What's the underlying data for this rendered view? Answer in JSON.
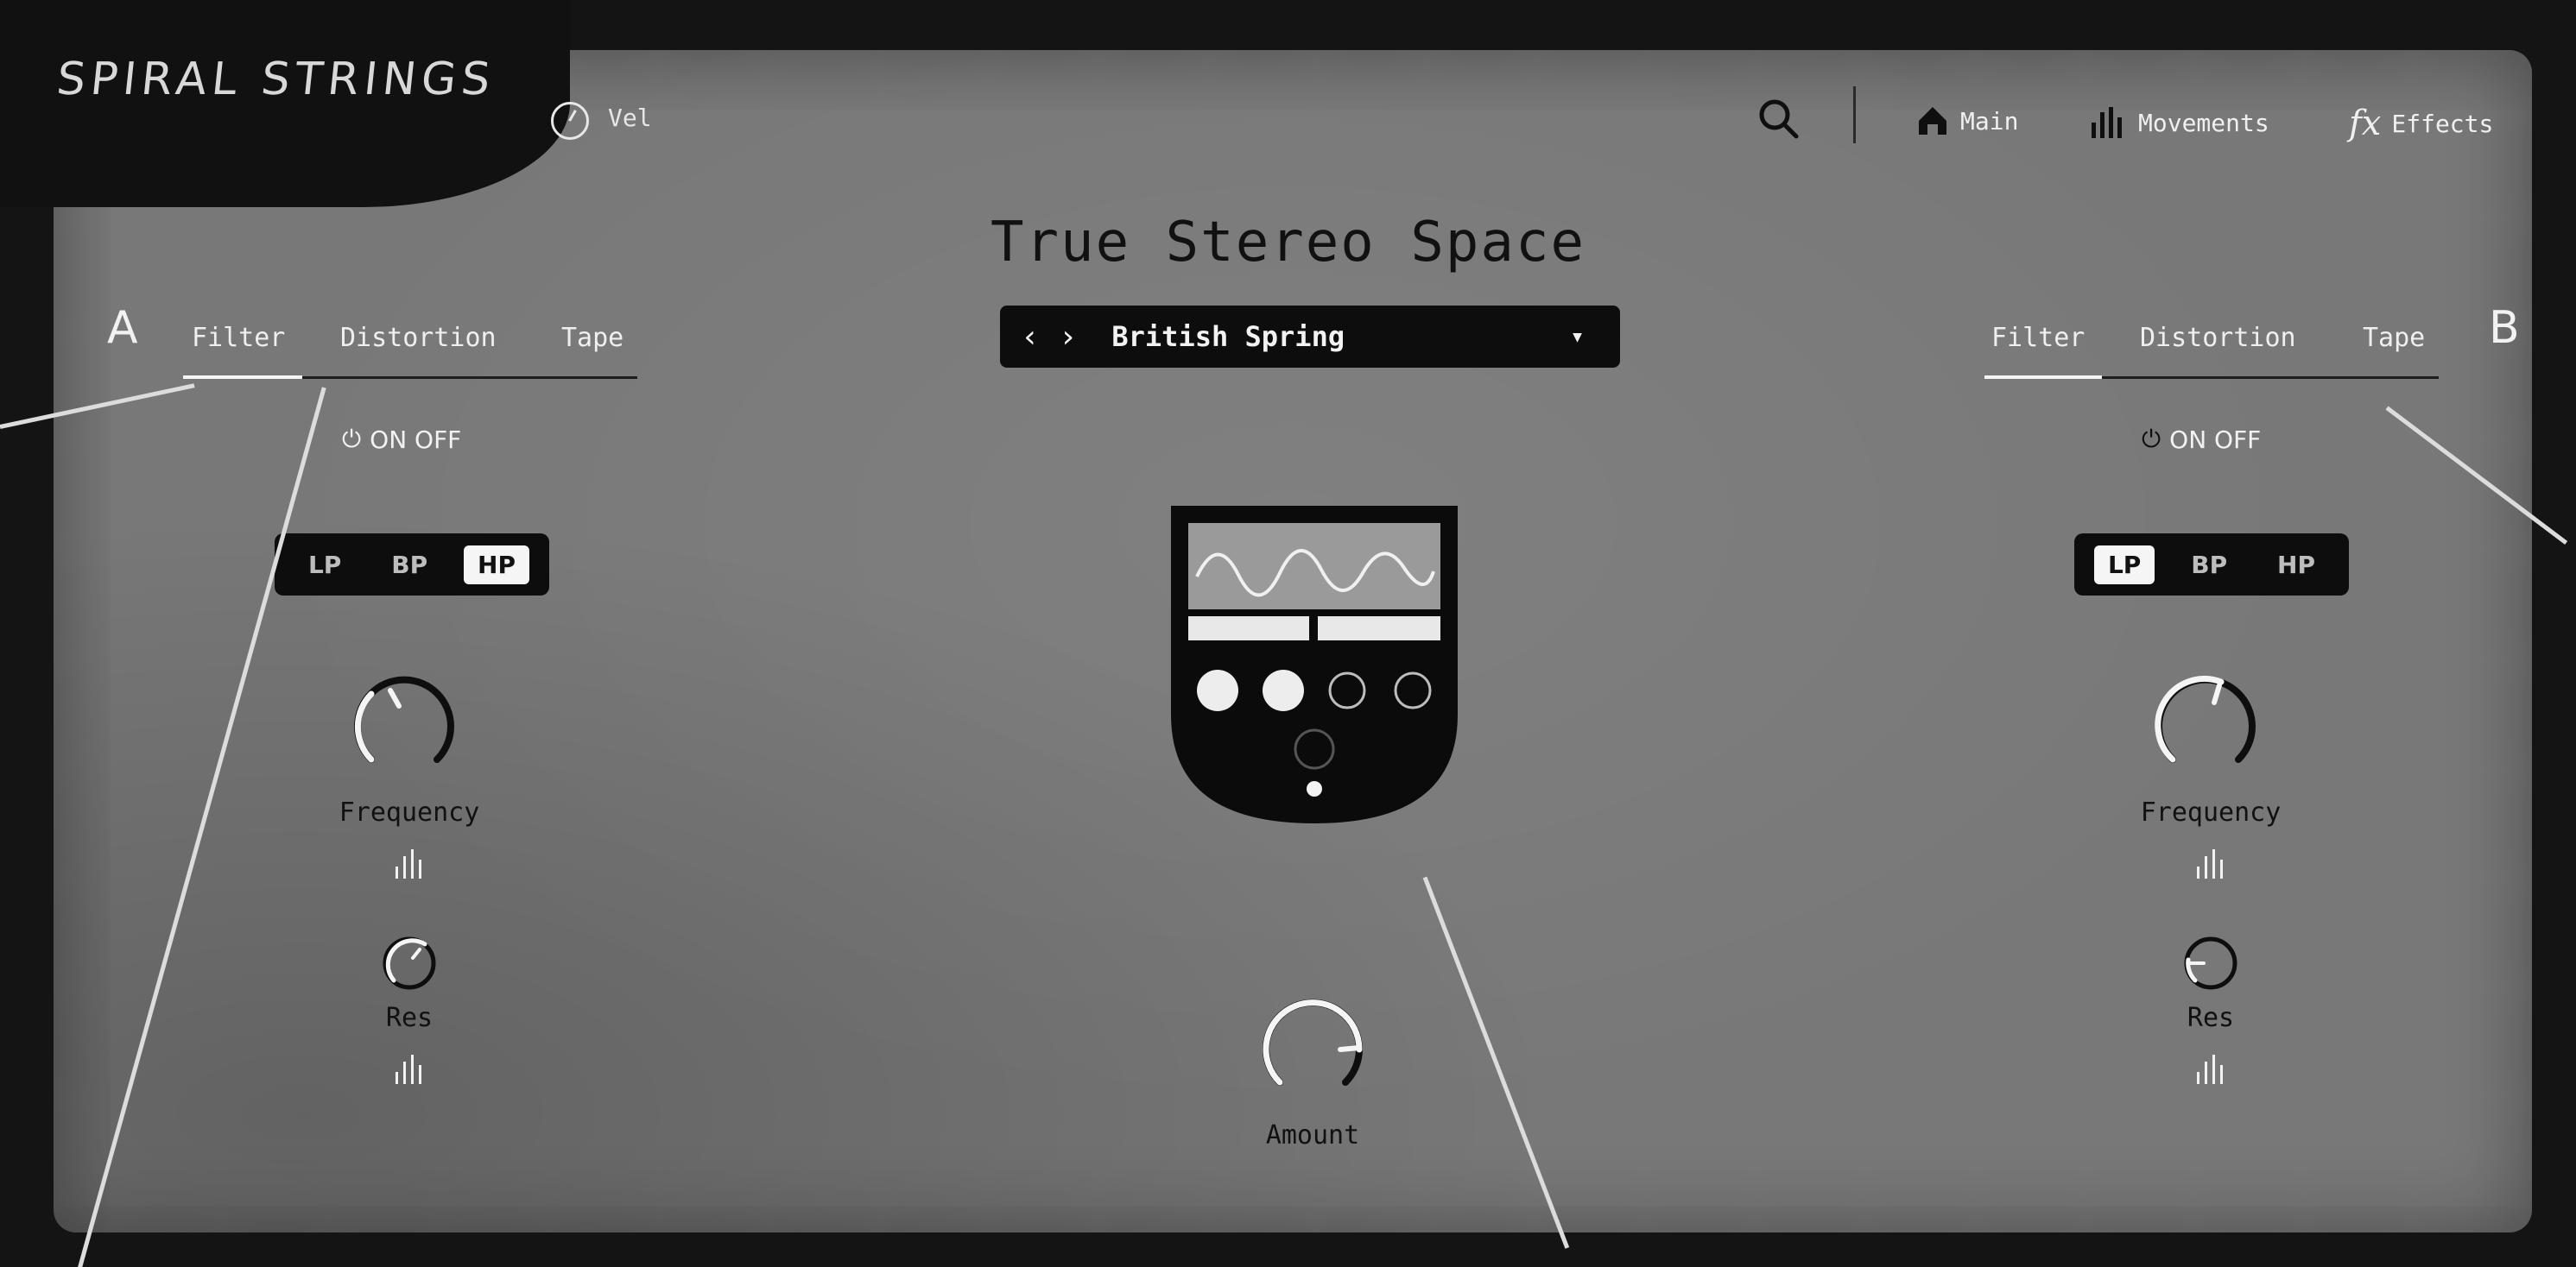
{
  "app": {
    "logo": "SPIRAL STRINGS",
    "vel_label": "Vel"
  },
  "nav": {
    "main": "Main",
    "movements": "Movements",
    "effects_prefix": "fx",
    "effects": "Effects",
    "icons": [
      "search-icon",
      "home-icon",
      "bars-icon",
      "fx-icon"
    ]
  },
  "effect": {
    "title": "True Stereo Space",
    "preset": "British Spring",
    "amount_label": "Amount",
    "amount_value": 0.8
  },
  "section_a": {
    "letter": "A",
    "tabs": [
      "Filter",
      "Distortion",
      "Tape"
    ],
    "active_tab": "Filter",
    "power": "ON OFF",
    "modes": [
      "LP",
      "BP",
      "HP"
    ],
    "active_mode": "HP",
    "frequency_label": "Frequency",
    "frequency_value": 0.55,
    "res_label": "Res",
    "res_value": 0.72
  },
  "section_b": {
    "letter": "B",
    "tabs": [
      "Filter",
      "Distortion",
      "Tape"
    ],
    "active_tab": "Filter",
    "power": "ON OFF",
    "modes": [
      "LP",
      "BP",
      "HP"
    ],
    "active_mode": "LP",
    "frequency_label": "Frequency",
    "frequency_value": 0.72,
    "res_label": "Res",
    "res_value": 0.25
  },
  "colors": {
    "frame": "#141414",
    "panel": "#787878",
    "control_bg": "#0d0d0d",
    "highlight": "#f5f5f5"
  }
}
